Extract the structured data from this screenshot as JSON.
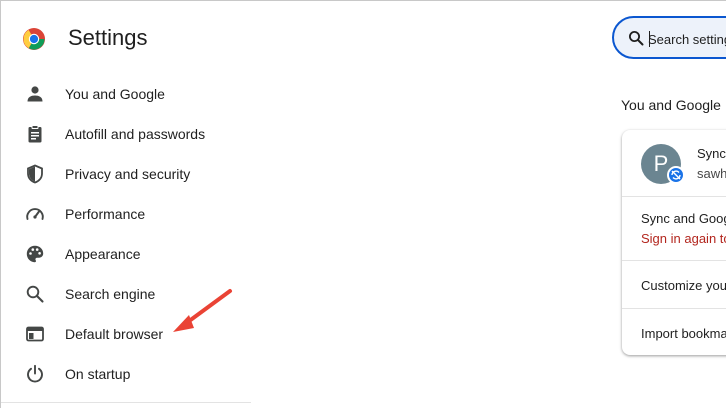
{
  "header": {
    "title": "Settings",
    "logo_icon": "chrome-logo-icon",
    "search": {
      "placeholder": "Search settings",
      "icon": "search-icon"
    }
  },
  "sidebar": {
    "items": [
      {
        "label": "You and Google",
        "icon": "person-icon"
      },
      {
        "label": "Autofill and passwords",
        "icon": "clipboard-icon"
      },
      {
        "label": "Privacy and security",
        "icon": "shield-icon"
      },
      {
        "label": "Performance",
        "icon": "speedometer-icon"
      },
      {
        "label": "Appearance",
        "icon": "palette-icon"
      },
      {
        "label": "Search engine",
        "icon": "search-icon"
      },
      {
        "label": "Default browser",
        "icon": "browser-window-icon"
      },
      {
        "label": "On startup",
        "icon": "power-icon"
      }
    ]
  },
  "main": {
    "section_title": "You and Google",
    "card": {
      "avatar_letter": "P",
      "sync_label": "Sync",
      "email": "sawh",
      "sync_and_google_label": "Sync and Goog",
      "sign_in_again_label": "Sign in again to",
      "customize_label": "Customize you",
      "import_label": "Import bookma"
    }
  },
  "annotation": {
    "arrow_color": "#ea4335",
    "arrow_target": "Default browser"
  },
  "colors": {
    "accent": "#0b57d0",
    "error_text": "#b3261e",
    "avatar_bg": "#6b8591"
  }
}
